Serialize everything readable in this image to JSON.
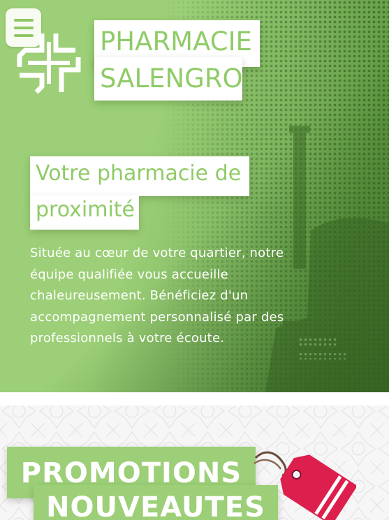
{
  "header": {
    "menu_icon": "hamburger-menu-icon",
    "logo_icon": "pharmacy-cross-logo-icon",
    "brand_line_1": "PHARMACIE",
    "brand_line_2": "SALENGRO"
  },
  "hero": {
    "tagline_line_1": "Votre pharmacie de",
    "tagline_line_2": "proximité",
    "intro_text": "Située au cœur de votre quartier, notre équipe qualifiée vous accueille chaleureusement. Bénéficiez d'un accompagnement personnalisé par des professionnels à votre écoute."
  },
  "promo": {
    "label_1": "PROMOTIONS",
    "label_2": "NOUVEAUTES",
    "tag_icon": "price-tag-icon"
  },
  "colors": {
    "brand_green": "#9ccf77",
    "brand_text_green": "#8fcb67",
    "dark_green": "#4e7d33",
    "tag_red": "#dc1f4c"
  }
}
